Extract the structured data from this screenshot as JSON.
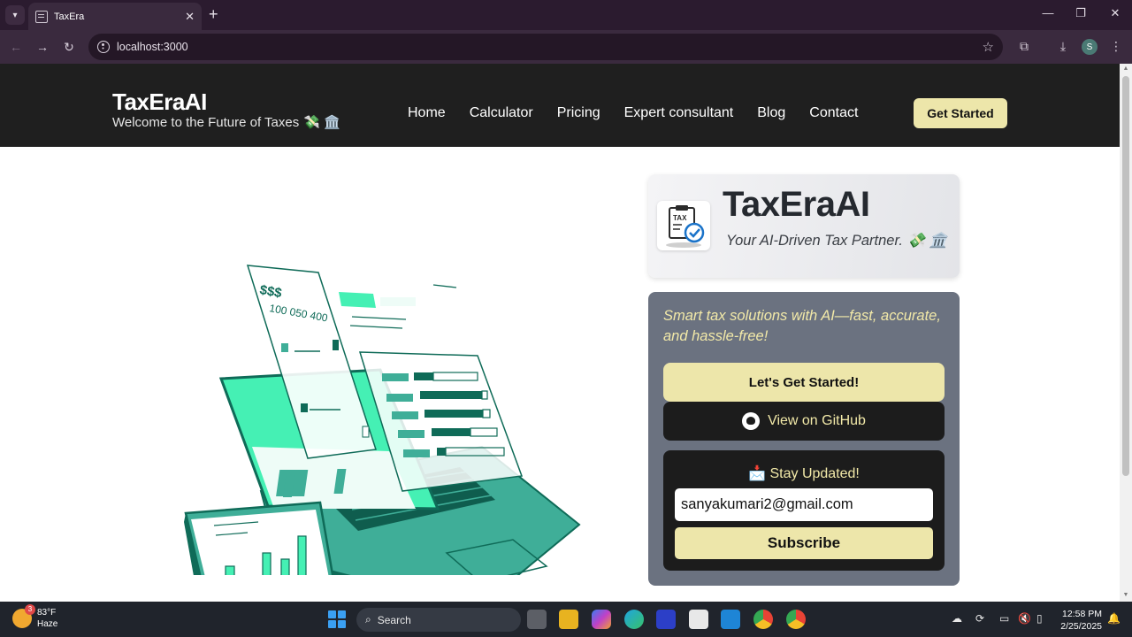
{
  "browser": {
    "tab_title": "TaxEra",
    "url": "localhost:3000",
    "profile_initial": "S",
    "new_tab_label": "+",
    "tab_close_label": "✕"
  },
  "header": {
    "brand": "TaxEraAI",
    "tagline": "Welcome to the Future of Taxes",
    "tagline_emojis": "💸 🏛️",
    "nav": [
      "Home",
      "Calculator",
      "Pricing",
      "Expert consultant",
      "Blog",
      "Contact"
    ],
    "cta_label": "Get Started"
  },
  "hero": {
    "illustration": {
      "doc_text_1": "$$$",
      "doc_text_2": "100 050 400"
    },
    "brand_card": {
      "logo_text": "TAX",
      "title": "TaxEraAI",
      "tagline": "Your AI-Driven Tax Partner. 💸 🏛️"
    },
    "cta_panel": {
      "description": "Smart tax solutions with AI—fast, accurate, and hassle-free!",
      "primary_button": "Let's Get Started!",
      "github_button": "View on GitHub",
      "newsletter": {
        "title": "📩 Stay Updated!",
        "email_value": "sanyakumari2@gmail.com",
        "subscribe_button": "Subscribe"
      }
    }
  },
  "taskbar": {
    "weather_temp": "83°F",
    "weather_desc": "Haze",
    "weather_badge": "3",
    "search_label": "Search",
    "time": "12:58 PM",
    "date": "2/25/2025"
  },
  "colors": {
    "header_bg": "#1f1f1f",
    "accent_cream": "#ede6aa",
    "panel_gray": "#6b7280",
    "illustration_teal": "#3fae98",
    "illustration_mint": "#4cf2b8",
    "tab_bar": "#2b1b2f"
  }
}
